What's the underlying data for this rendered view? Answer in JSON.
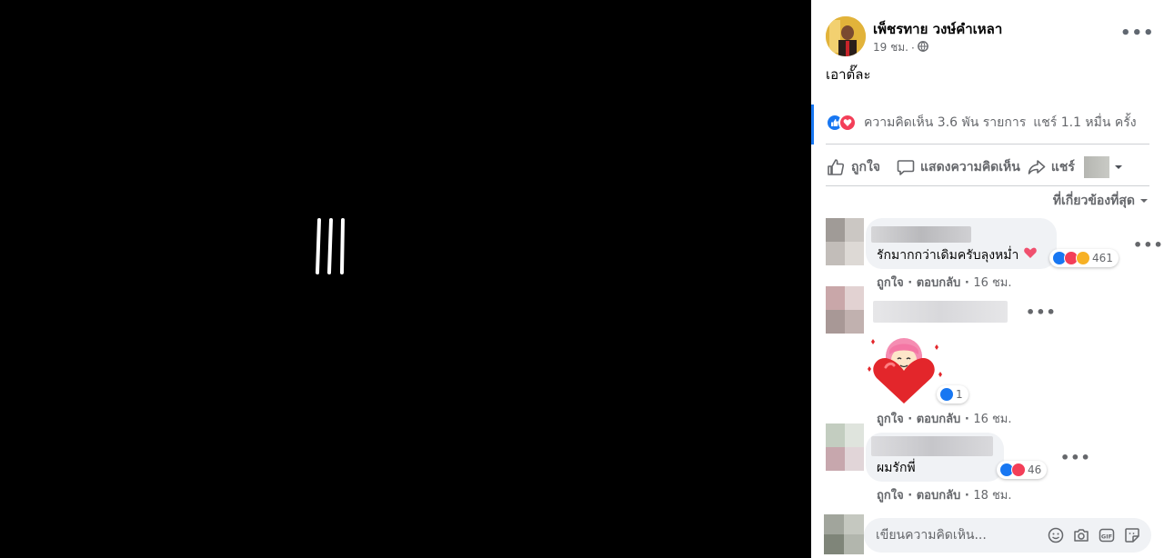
{
  "post": {
    "author": "เพ็ชรทาย วงษ์คำเหลา",
    "time": "19 ชม.",
    "separator": "·",
    "caption": "เอาตั๊ละ"
  },
  "stats": {
    "comments": "ความคิดเห็น 3.6 พัน รายการ",
    "shares": "แชร์ 1.1 หมื่น ครั้ง"
  },
  "actions": {
    "like": "ถูกใจ",
    "comment": "แสดงความคิดเห็น",
    "share": "แชร์"
  },
  "sort_label": "ที่เกี่ยวข้องที่สุด",
  "comments": [
    {
      "text": "รักมากกว่าเดิมครับลุงหม่ำ",
      "reaction_count": "461",
      "like": "ถูกใจ",
      "reply": "ตอบกลับ",
      "time": "16 ชม."
    },
    {
      "text": "",
      "reaction_count": "1",
      "like": "ถูกใจ",
      "reply": "ตอบกลับ",
      "time": "16 ชม."
    },
    {
      "text": "ผมรักพี่",
      "reaction_count": "46",
      "like": "ถูกใจ",
      "reply": "ตอบกลับ",
      "time": "18 ชม."
    }
  ],
  "composer": {
    "placeholder": "เขียนความคิดเห็น..."
  },
  "colors": {
    "brand": "#1877f2",
    "love": "#f33e58",
    "care": "#f7b125",
    "bubble": "#f0f2f5",
    "muted": "#65676b"
  },
  "icons": [
    "like-icon",
    "love-icon",
    "care-icon",
    "globe-icon",
    "thumb-up-icon",
    "comment-icon",
    "share-icon",
    "chevron-down-icon",
    "more-icon",
    "emoji-icon",
    "camera-icon",
    "gif-icon",
    "sticker-icon"
  ]
}
